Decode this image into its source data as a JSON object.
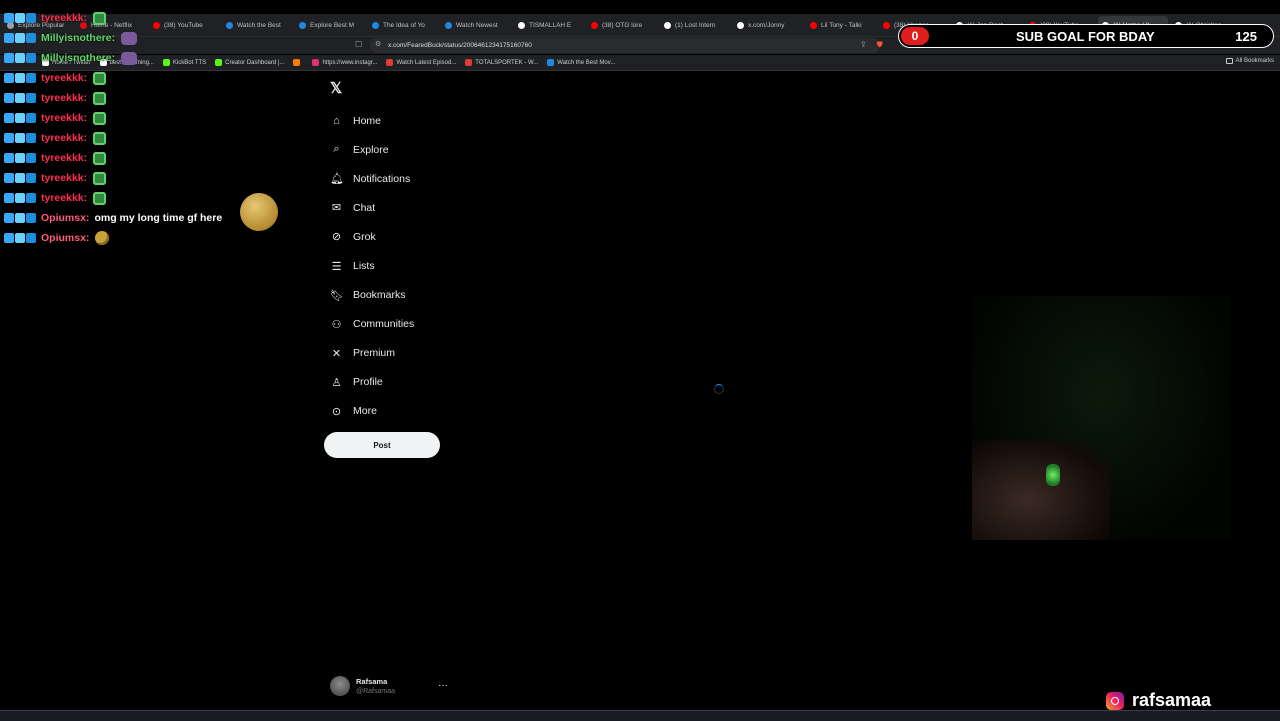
{
  "browser": {
    "tabs": [
      {
        "label": "Explore Popular",
        "color": "#9aa0a6"
      },
      {
        "label": "Home - Netflix",
        "color": "#e50914"
      },
      {
        "label": "(38) YouTube",
        "color": "#ff0000"
      },
      {
        "label": "Watch the Best",
        "color": "#1e88e5"
      },
      {
        "label": "Explore Best M",
        "color": "#1e88e5"
      },
      {
        "label": "The Idea of Yo",
        "color": "#1e88e5"
      },
      {
        "label": "Watch Newest",
        "color": "#1e88e5"
      },
      {
        "label": "TISMALLAH E",
        "color": "#ffffff"
      },
      {
        "label": "(38) OTG lore",
        "color": "#ff0000"
      },
      {
        "label": "(1) Lost Intern",
        "color": "#ffffff"
      },
      {
        "label": "x.com/Jonny",
        "color": "#ffffff"
      },
      {
        "label": "Lil Tony - Talki",
        "color": "#ff0000"
      },
      {
        "label": "(38) Venzos -",
        "color": "#ff0000"
      },
      {
        "label": "(1) Jon Root",
        "color": "#ffffff"
      },
      {
        "label": "(38) YouTube",
        "color": "#ff0000"
      },
      {
        "label": "(1) Home / X",
        "color": "#ffffff"
      },
      {
        "label": "(1) Christina",
        "color": "#ffffff"
      }
    ],
    "url": "x.com/FearedBuck/status/2006461234175160760",
    "bookmarks": [
      {
        "label": "Home / Twitter",
        "color": "#ffffff"
      },
      {
        "label": "best streaming...",
        "color": "#ffffff"
      },
      {
        "label": "KickBot TTS",
        "color": "#53fc18"
      },
      {
        "label": "Creator Dashboard |...",
        "color": "#53fc18"
      },
      {
        "label": "",
        "color": "#ff7b00"
      },
      {
        "label": "https://www.instagr...",
        "color": "#e1306c"
      },
      {
        "label": "Watch Latest Episod...",
        "color": "#e53935"
      },
      {
        "label": "TOTALSPORTEK - W...",
        "color": "#e53935"
      },
      {
        "label": "Watch the Best Mov...",
        "color": "#1e88e5"
      }
    ],
    "all_bookmarks": "All Bookmarks"
  },
  "sub_goal": {
    "current": "0",
    "title": "SUB GOAL FOR BDAY",
    "target": "125"
  },
  "chat": {
    "messages": [
      {
        "user": "tyreekkk:",
        "color": "#ff2e4f",
        "text": "",
        "emote": "green"
      },
      {
        "user": "Millyisnothere:",
        "color": "#5dd66a",
        "text": "",
        "emote": "purple"
      },
      {
        "user": "Millyisnothere:",
        "color": "#5dd66a",
        "text": "",
        "emote": "purple"
      },
      {
        "user": "tyreekkk:",
        "color": "#ff2e4f",
        "text": "",
        "emote": "green"
      },
      {
        "user": "tyreekkk:",
        "color": "#ff2e4f",
        "text": "",
        "emote": "green"
      },
      {
        "user": "tyreekkk:",
        "color": "#ff2e4f",
        "text": "",
        "emote": "green"
      },
      {
        "user": "tyreekkk:",
        "color": "#ff2e4f",
        "text": "",
        "emote": "green"
      },
      {
        "user": "tyreekkk:",
        "color": "#ff2e4f",
        "text": "",
        "emote": "green"
      },
      {
        "user": "tyreekkk:",
        "color": "#ff2e4f",
        "text": "",
        "emote": "green"
      },
      {
        "user": "tyreekkk:",
        "color": "#ff2e4f",
        "text": "",
        "emote": "green"
      },
      {
        "user": "Opiumsx:",
        "color": "#ff5c7a",
        "text": "omg my long time gf here",
        "emote": ""
      },
      {
        "user": "Opiumsx:",
        "color": "#ff5c7a",
        "text": "",
        "emote": "coin"
      }
    ]
  },
  "x_sidebar": {
    "logo_icon": "x-logo-icon",
    "nav": [
      {
        "label": "Home",
        "icon": "home-icon",
        "glyph": "⌂"
      },
      {
        "label": "Explore",
        "icon": "search-icon",
        "glyph": "⌕"
      },
      {
        "label": "Notifications",
        "icon": "bell-icon",
        "glyph": "🔔︎"
      },
      {
        "label": "Chat",
        "icon": "mail-icon",
        "glyph": "✉"
      },
      {
        "label": "Grok",
        "icon": "grok-icon",
        "glyph": "⊘"
      },
      {
        "label": "Lists",
        "icon": "list-icon",
        "glyph": "☰"
      },
      {
        "label": "Bookmarks",
        "icon": "bookmark-icon",
        "glyph": "🔖︎"
      },
      {
        "label": "Communities",
        "icon": "communities-icon",
        "glyph": "⚇"
      },
      {
        "label": "Premium",
        "icon": "x-premium-icon",
        "glyph": "✕"
      },
      {
        "label": "Profile",
        "icon": "person-icon",
        "glyph": "♙"
      },
      {
        "label": "More",
        "icon": "more-circle-icon",
        "glyph": "⊙"
      }
    ],
    "post_label": "Post",
    "account": {
      "name": "Rafsama",
      "handle": "@Rafsamaa",
      "more": "···"
    }
  },
  "stream": {
    "instagram_handle": "rafsamaa"
  }
}
